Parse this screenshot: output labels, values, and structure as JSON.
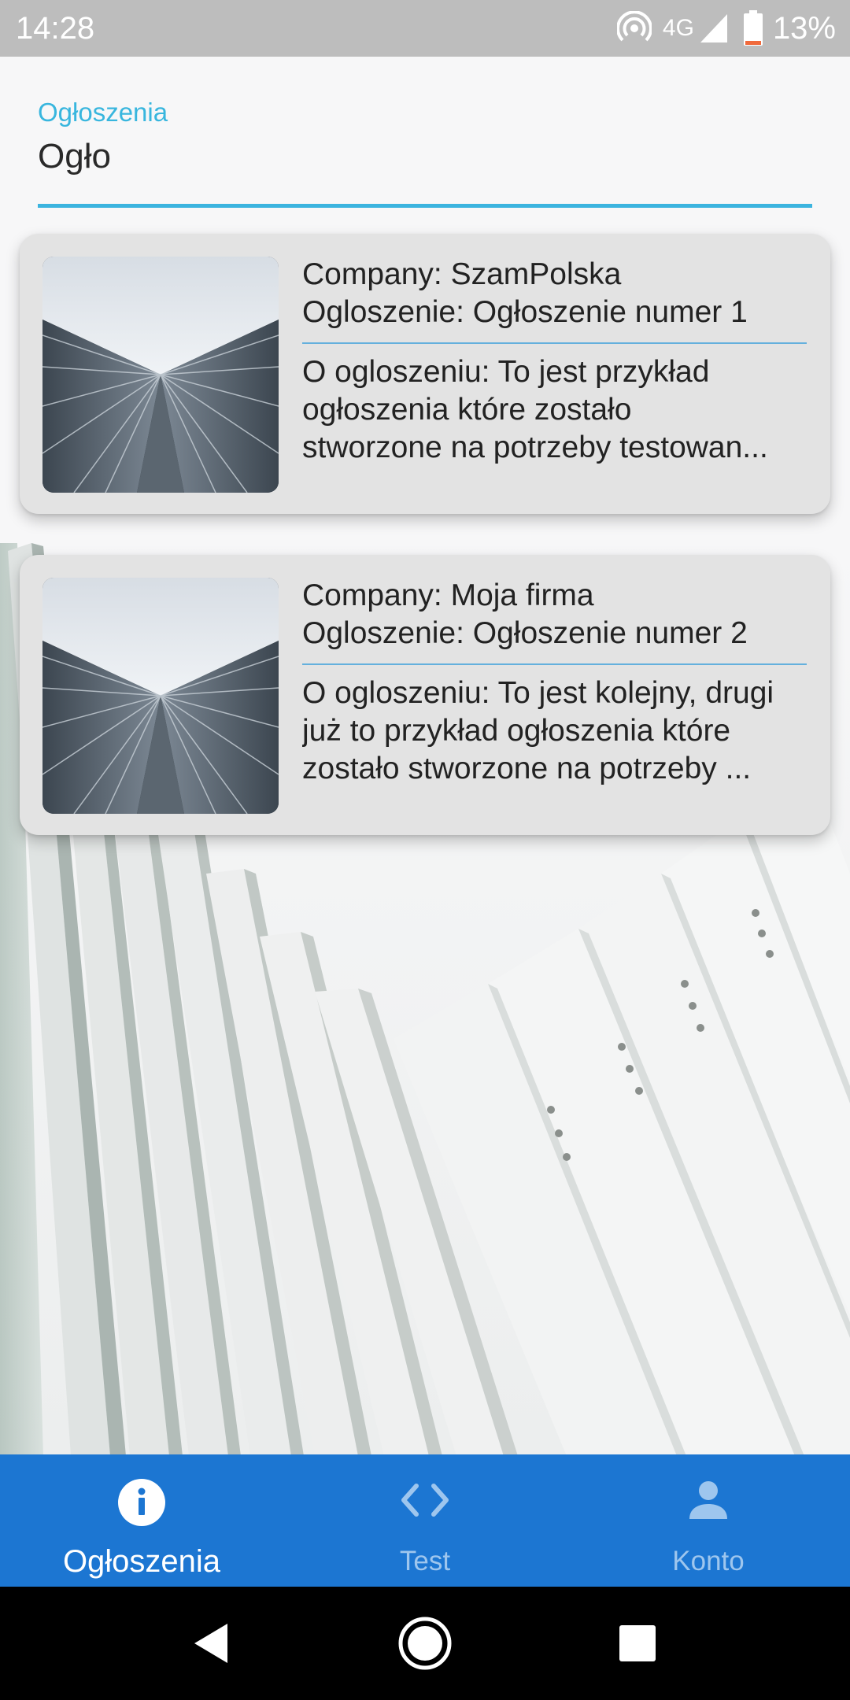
{
  "status_bar": {
    "time": "14:28",
    "network": "4G",
    "battery": "13%"
  },
  "search": {
    "label": "Ogłoszenia",
    "value": "Ogło"
  },
  "listings": [
    {
      "company": "Company: SzamPolska",
      "title": "Ogloszenie: Ogłoszenie numer 1",
      "desc_lines": [
        "O ogloszeniu: To jest przykład",
        "ogłoszenia które zostało",
        "stworzone na potrzeby testowan..."
      ]
    },
    {
      "company": "Company: Moja firma",
      "title": "Ogloszenie: Ogłoszenie numer 2",
      "desc_lines": [
        "O ogloszeniu: To jest kolejny, drugi",
        "już to przykład ogłoszenia które",
        "zostało stworzone na potrzeby ..."
      ]
    }
  ],
  "bottom_nav": {
    "items": [
      {
        "label": "Ogłoszenia",
        "icon": "info-icon",
        "active": true
      },
      {
        "label": "Test",
        "icon": "code-icon",
        "active": false
      },
      {
        "label": "Konto",
        "icon": "person-icon",
        "active": false
      }
    ]
  },
  "colors": {
    "accent": "#3cb4df",
    "nav_background": "#1c76d2",
    "card_background": "#e3e3e3"
  }
}
